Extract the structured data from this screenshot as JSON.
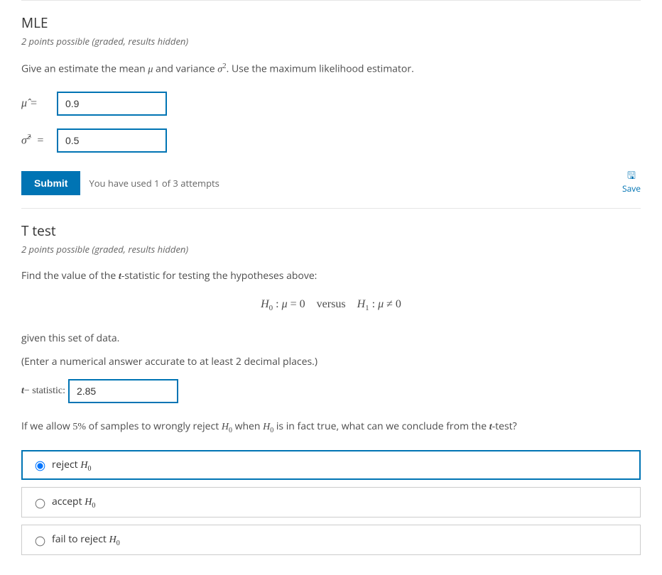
{
  "mle": {
    "title": "MLE",
    "points": "2 points possible (graded, results hidden)",
    "prompt_pre": "Give an estimate the mean ",
    "prompt_mid": " and variance ",
    "prompt_post": ". Use the maximum likelihood estimator.",
    "mu_value": "0.9",
    "sigma2_value": "0.5",
    "submit_label": "Submit",
    "attempts_text": "You have used 1 of 3 attempts",
    "save_label": "Save"
  },
  "ttest": {
    "title": "T test",
    "points": "2 points possible (graded, results hidden)",
    "prompt1_pre": "Find the value of the ",
    "prompt1_post": "-statistic for testing the hypotheses above:",
    "given_text": "given this set of data.",
    "enter_text": "(Enter a numerical answer accurate to at least 2 decimal places.)",
    "t_label_post": " statistic:",
    "t_value": "2.85",
    "conclude_pre": "If we allow ",
    "conclude_percent": "5%",
    "conclude_mid": " of samples to wrongly reject ",
    "conclude_mid2": " when ",
    "conclude_mid3": " is in fact true, what can we conclude from the ",
    "conclude_post": "-test?",
    "options": {
      "reject": "reject ",
      "accept": "accept ",
      "fail": "fail to reject "
    }
  }
}
